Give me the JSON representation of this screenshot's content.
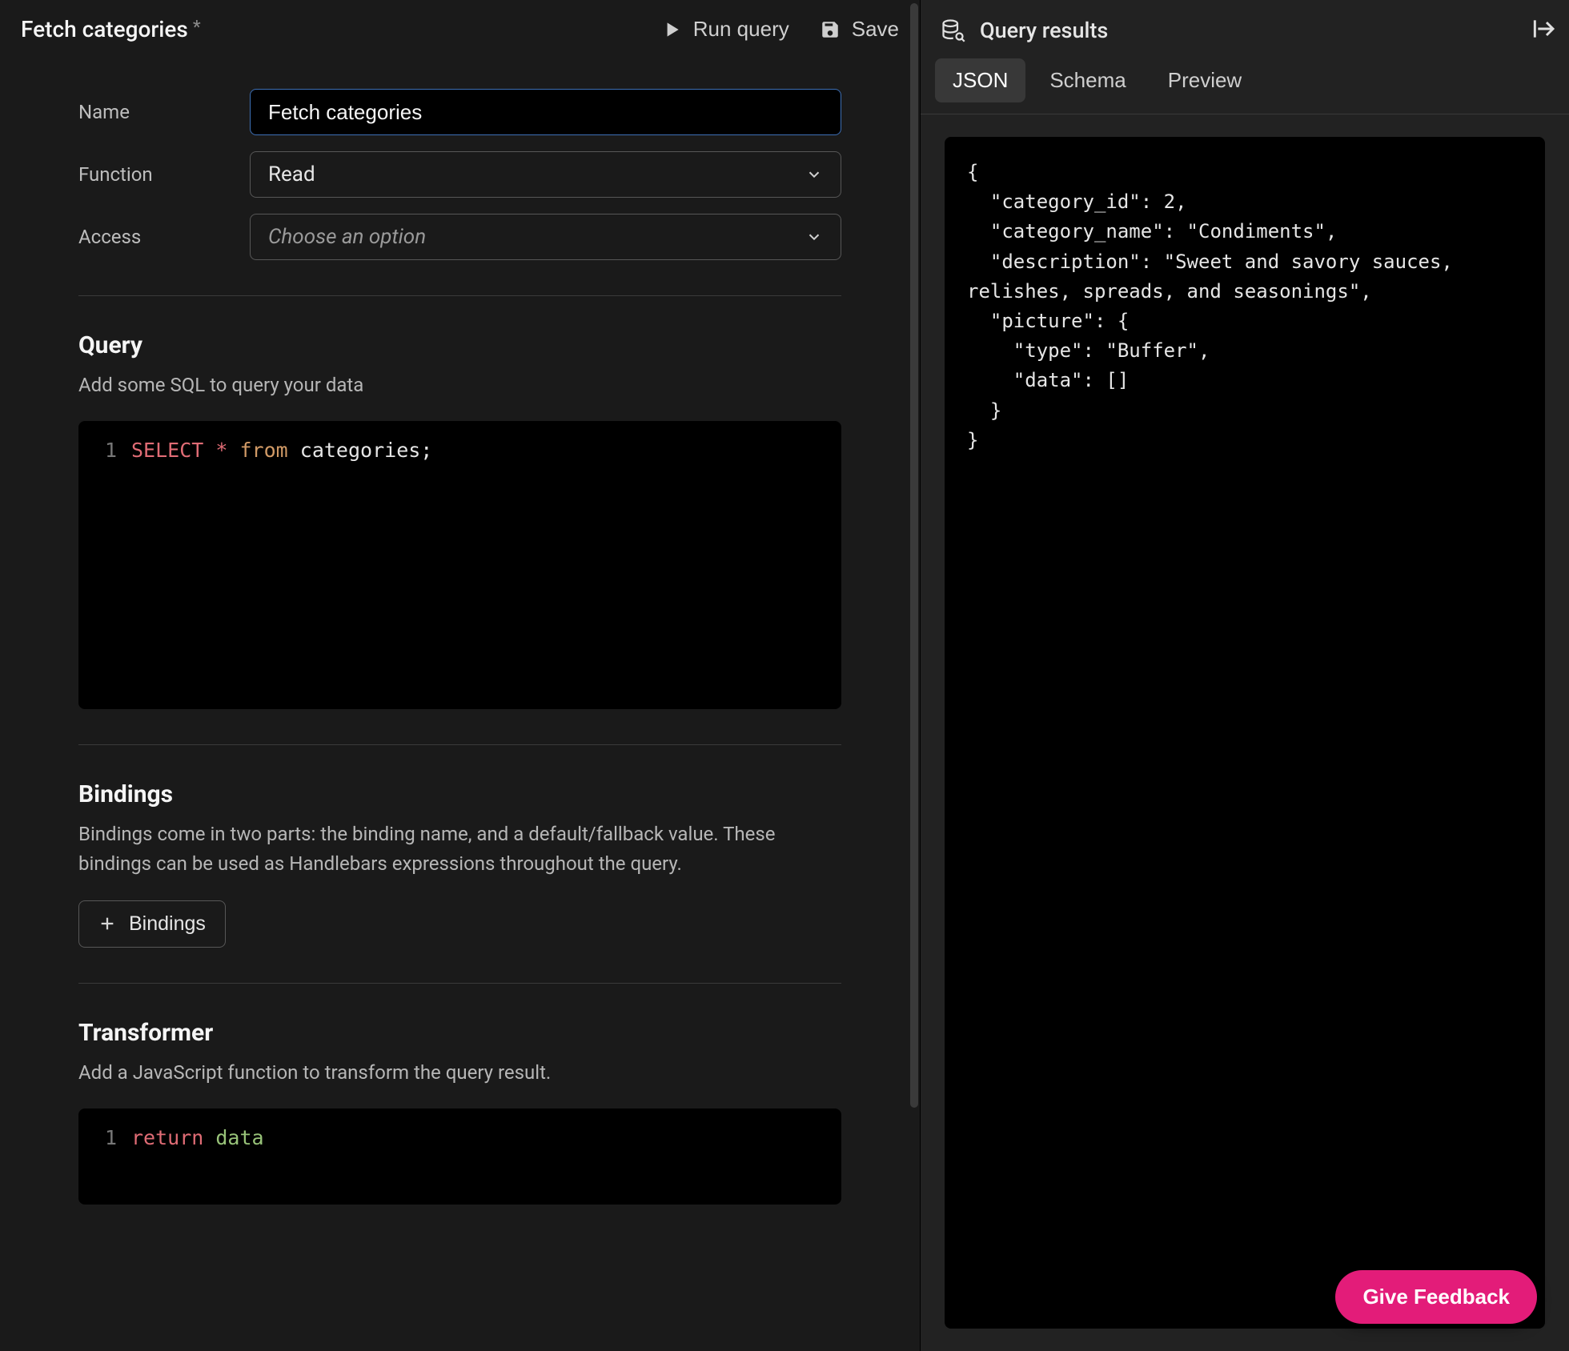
{
  "header": {
    "title": "Fetch categories",
    "dirty_marker": "*",
    "run_label": "Run query",
    "save_label": "Save"
  },
  "form": {
    "name_label": "Name",
    "name_value": "Fetch categories",
    "function_label": "Function",
    "function_value": "Read",
    "access_label": "Access",
    "access_placeholder": "Choose an option"
  },
  "query": {
    "title": "Query",
    "subtitle": "Add some SQL to query your data",
    "line_number": "1",
    "tok_select": "SELECT",
    "tok_star": "*",
    "tok_from": "from",
    "tok_rest": "categories;"
  },
  "bindings": {
    "title": "Bindings",
    "subtitle": "Bindings come in two parts: the binding name, and a default/fallback value. These bindings can be used as Handlebars expressions throughout the query.",
    "button_label": "Bindings"
  },
  "transformer": {
    "title": "Transformer",
    "subtitle": "Add a JavaScript function to transform the query result.",
    "line_number": "1",
    "tok_return": "return",
    "tok_data": "data"
  },
  "results": {
    "title": "Query results",
    "tabs": {
      "json": "JSON",
      "schema": "Schema",
      "preview": "Preview"
    },
    "json_text": "{\n  \"category_id\": 2,\n  \"category_name\": \"Condiments\",\n  \"description\": \"Sweet and savory sauces, relishes, spreads, and seasonings\",\n  \"picture\": {\n    \"type\": \"Buffer\",\n    \"data\": []\n  }\n}"
  },
  "feedback": {
    "label": "Give Feedback"
  }
}
